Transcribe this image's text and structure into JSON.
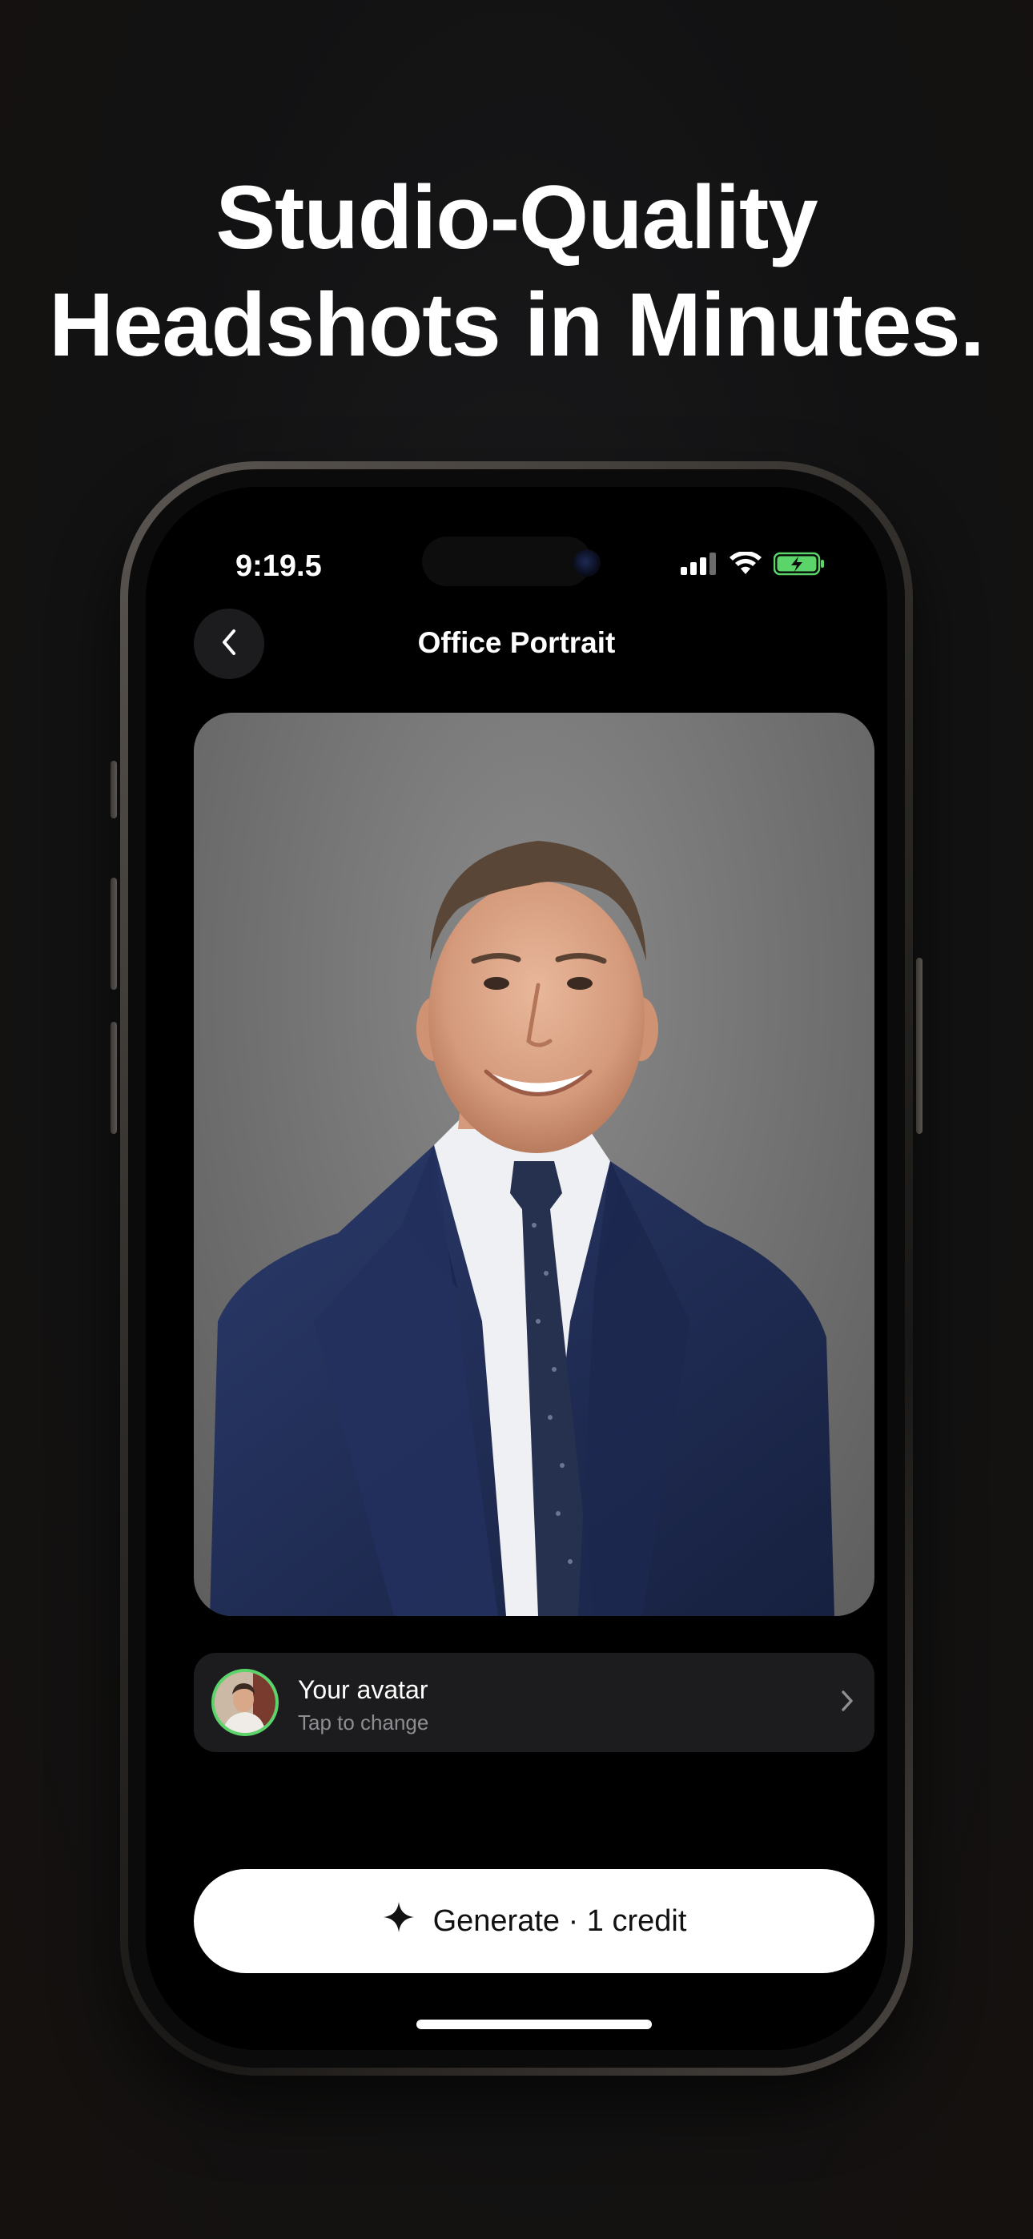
{
  "headline": {
    "line1": "Studio-Quality",
    "line2": "Headshots in Minutes."
  },
  "status_bar": {
    "time": "9:19.5",
    "icons": [
      "signal-icon",
      "wifi-icon",
      "battery-charging-icon"
    ]
  },
  "nav": {
    "back_icon": "chevron-left-icon",
    "title": "Office Portrait"
  },
  "avatar_row": {
    "title": "Your avatar",
    "subtitle": "Tap to change",
    "chevron_icon": "chevron-right-icon"
  },
  "generate": {
    "icon": "sparkle-icon",
    "label": "Generate · 1 credit"
  },
  "colors": {
    "accent_green": "#5bd46a",
    "button_bg": "#ffffff",
    "card_bg": "#1c1c1e"
  }
}
